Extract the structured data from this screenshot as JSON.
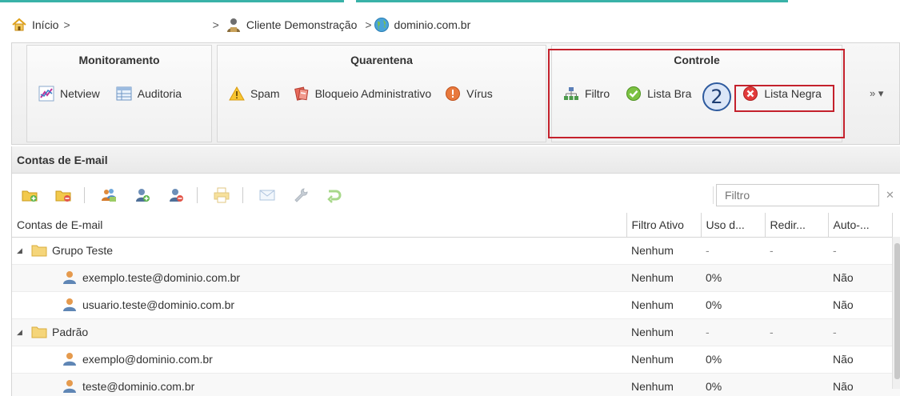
{
  "breadcrumb": {
    "home": "Início",
    "sep1": ">",
    "sep2": ">",
    "client": "Cliente Demonstração",
    "sep3": ">",
    "domain": "dominio.com.br"
  },
  "ribbon": {
    "groups": [
      {
        "title": "Monitoramento",
        "items": [
          "Netview",
          "Auditoria"
        ]
      },
      {
        "title": "Quarentena",
        "items": [
          "Spam",
          "Bloqueio Administrativo",
          "Vírus"
        ]
      },
      {
        "title": "Controle",
        "items": [
          "Filtro",
          "Lista Bra",
          "Lista Negra"
        ]
      }
    ],
    "step_badge": "2",
    "more": "»  ▾"
  },
  "panel": {
    "title": "Contas de E-mail",
    "filter_placeholder": "Filtro",
    "filter_clear": "✕"
  },
  "table": {
    "columns": [
      "Contas de E-mail",
      "Filtro Ativo",
      "Uso d...",
      "Redir...",
      "Auto-..."
    ],
    "rows": [
      {
        "type": "group",
        "name": "Grupo Teste",
        "filtro": "Nenhum",
        "uso": "-",
        "redir": "-",
        "auto": "-"
      },
      {
        "type": "account",
        "name": "exemplo.teste@dominio.com.br",
        "filtro": "Nenhum",
        "uso": "0%",
        "redir": "",
        "auto": "Não"
      },
      {
        "type": "account",
        "name": "usuario.teste@dominio.com.br",
        "filtro": "Nenhum",
        "uso": "0%",
        "redir": "",
        "auto": "Não"
      },
      {
        "type": "group",
        "name": "Padrão",
        "filtro": "Nenhum",
        "uso": "-",
        "redir": "-",
        "auto": "-"
      },
      {
        "type": "account",
        "name": "exemplo@dominio.com.br",
        "filtro": "Nenhum",
        "uso": "0%",
        "redir": "",
        "auto": "Não"
      },
      {
        "type": "account",
        "name": "teste@dominio.com.br",
        "filtro": "Nenhum",
        "uso": "0%",
        "redir": "",
        "auto": "Não"
      }
    ]
  },
  "colors": {
    "highlight": "#c4212c",
    "badge_border": "#2d5a9e",
    "teal_strip": "#39b2a8"
  }
}
